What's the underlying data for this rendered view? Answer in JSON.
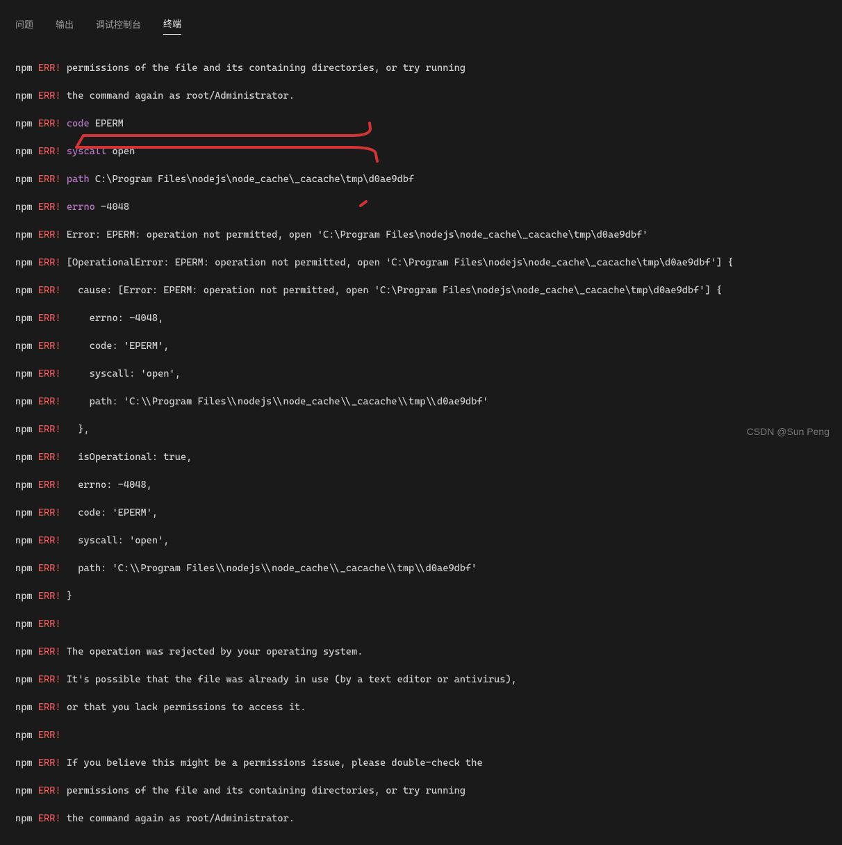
{
  "tabs": {
    "problems": "问题",
    "output": "输出",
    "debug": "调试控制台",
    "terminal": "终端"
  },
  "active_tab": "terminal",
  "prefix": "npm",
  "errmark": "ERR!",
  "lines": {
    "l0": "permissions of the file and its containing directories, or try running",
    "l1": "the command again as root/Administrator.",
    "l2k": "code",
    "l2v": "EPERM",
    "l3k": "syscall",
    "l3v": "open",
    "l4k": "path",
    "l4v": "C:\\Program Files\\nodejs\\node_cache\\_cacache\\tmp\\d0ae9dbf",
    "l5k": "errno",
    "l5v": "-4048",
    "l6": "Error: EPERM: operation not permitted, open 'C:\\Program Files\\nodejs\\node_cache\\_cacache\\tmp\\d0ae9dbf'",
    "l7": " [OperationalError: EPERM: operation not permitted, open 'C:\\Program Files\\nodejs\\node_cache\\_cacache\\tmp\\d0ae9dbf'] {",
    "l8": "   cause: [Error: EPERM: operation not permitted, open 'C:\\Program Files\\nodejs\\node_cache\\_cacache\\tmp\\d0ae9dbf'] {",
    "l9": "     errno: -4048,",
    "l10": "     code: 'EPERM',",
    "l11": "     syscall: 'open',",
    "l12": "     path: 'C:\\\\Program Files\\\\nodejs\\\\node_cache\\\\_cacache\\\\tmp\\\\d0ae9dbf'",
    "l13": "   },",
    "l14": "   isOperational: true,",
    "l15": "   errno: -4048,",
    "l16": "   code: 'EPERM',",
    "l17": "   syscall: 'open',",
    "l18": "   path: 'C:\\\\Program Files\\\\nodejs\\\\node_cache\\\\_cacache\\\\tmp\\\\d0ae9dbf'",
    "l19": " }",
    "l20": "",
    "l21": " The operation was rejected by your operating system.",
    "l22": " It's possible that the file was already in use (by a text editor or antivirus),",
    "l23": " or that you lack permissions to access it.",
    "l24": "",
    "l25": " If you believe this might be a permissions issue, please double-check the",
    "l26": " permissions of the file and its containing directories, or try running",
    "l27": " the command again as root/Administrator."
  },
  "watermark": "CSDN @Sun  Peng"
}
